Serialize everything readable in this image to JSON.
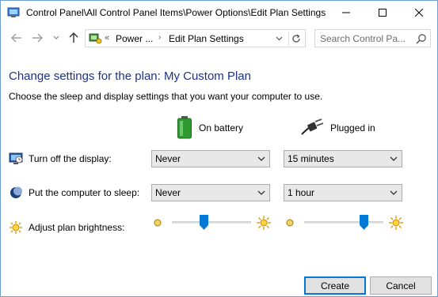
{
  "window": {
    "title": "Control Panel\\All Control Panel Items\\Power Options\\Edit Plan Settings"
  },
  "address_bar": {
    "overflow_marker": "«",
    "segment_1": "Power ...",
    "separator": "›",
    "segment_2": "Edit Plan Settings"
  },
  "search": {
    "placeholder": "Search Control Pa..."
  },
  "content": {
    "heading": "Change settings for the plan: My Custom Plan",
    "subtext": "Choose the sleep and display settings that you want your computer to use.",
    "col_battery": "On battery",
    "col_plugged": "Plugged in",
    "rows": [
      {
        "label": "Turn off the display:",
        "battery": "Never",
        "plugged": "15 minutes",
        "icon": "display-icon"
      },
      {
        "label": "Put the computer to sleep:",
        "battery": "Never",
        "plugged": "1 hour",
        "icon": "moon-icon"
      },
      {
        "label": "Adjust plan brightness:",
        "icon": "sun-icon"
      }
    ],
    "brightness": {
      "battery_percent": 40,
      "plugged_percent": 75
    }
  },
  "buttons": {
    "create": "Create",
    "cancel": "Cancel"
  },
  "colors": {
    "heading": "#1e3287",
    "slider_thumb": "#0078d7",
    "titlebar_border": "#6f9fd0"
  }
}
